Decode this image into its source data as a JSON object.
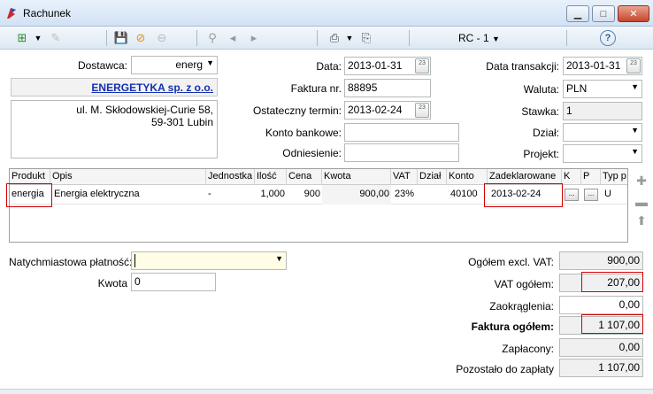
{
  "window": {
    "title": "Rachunek"
  },
  "toolbar": {
    "period": "RC - 1"
  },
  "supplier": {
    "label": "Dostawca:",
    "code": "energ",
    "name": "ENERGETYKA sp. z o.o.",
    "address_line1": "ul. M. Skłodowskiej-Curie 58,",
    "address_line2": "59-301  Lubin"
  },
  "doc": {
    "date_label": "Data:",
    "date": "2013-01-31",
    "invoice_label": "Faktura nr.",
    "invoice_no": "88895",
    "deadline_label": "Ostateczny termin:",
    "deadline": "2013-02-24",
    "bank_label": "Konto bankowe:",
    "bank": "",
    "reference_label": "Odniesienie:",
    "reference": ""
  },
  "right": {
    "tx_date_label": "Data transakcji:",
    "tx_date": "2013-01-31",
    "currency_label": "Waluta:",
    "currency": "PLN",
    "rate_label": "Stawka:",
    "rate": "1",
    "dept_label": "Dział:",
    "dept": "",
    "project_label": "Projekt:",
    "project": ""
  },
  "grid": {
    "headers": [
      "Produkt",
      "Opis",
      "Jednostka",
      "Ilość",
      "Cena",
      "Kwota",
      "VAT",
      "Dział",
      "Konto",
      "Zadeklarowane",
      "K",
      "P",
      "Typ p"
    ],
    "row": {
      "product": "energia",
      "description": "Energia elektryczna",
      "unit": "-",
      "qty": "1,000",
      "price": "900",
      "amount": "900,00",
      "vat": "23%",
      "dept": "",
      "account": "40100",
      "declared": "2013-02-24",
      "k_btn": "...",
      "p_btn": "...",
      "type": "U"
    }
  },
  "payment": {
    "immediate_label": "Natychmiastowa płatność:",
    "immediate_value": "",
    "amount_label": "Kwota",
    "amount_value": "0"
  },
  "totals": {
    "excl_label": "Ogółem excl. VAT:",
    "excl": "900,00",
    "vat_label": "VAT ogółem:",
    "vat": "207,00",
    "round_label": "Zaokrąglenia:",
    "round": "0,00",
    "total_label": "Faktura ogółem:",
    "total": "1 107,00",
    "paid_label": "Zapłacony:",
    "paid": "0,00",
    "remaining_label": "Pozostało do zapłaty",
    "remaining": "1 107,00"
  },
  "colors": {
    "highlight": "#d40000",
    "link": "#1530b0"
  }
}
